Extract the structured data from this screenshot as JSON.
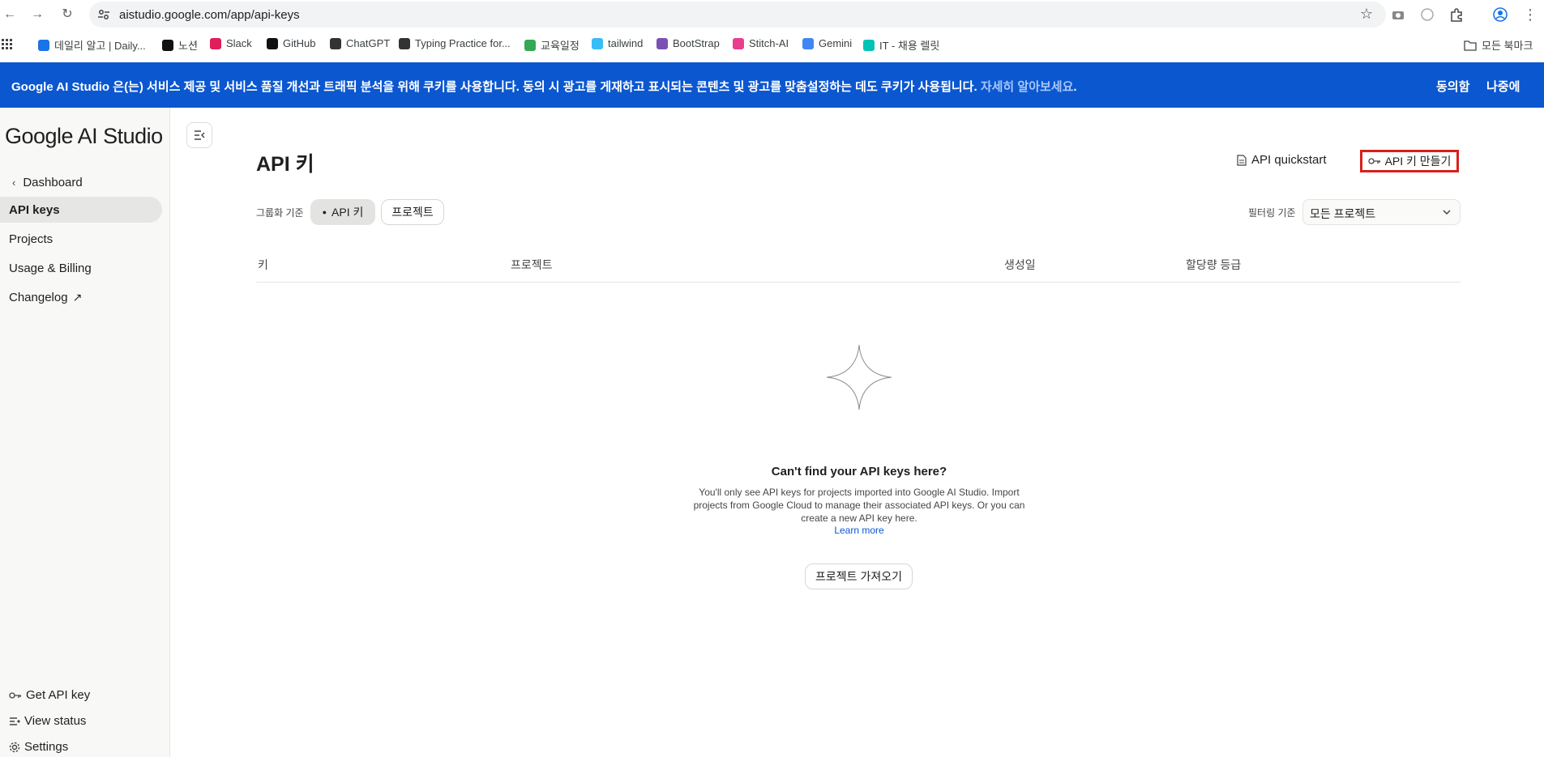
{
  "browser": {
    "url": "aistudio.google.com/app/api-keys",
    "bookmarks": [
      {
        "label": "데일리 알고 | Daily...",
        "icon": "daily-algo-icon",
        "color": "#1a73e8"
      },
      {
        "label": "노션",
        "icon": "notion-icon",
        "color": "#111111"
      },
      {
        "label": "Slack",
        "icon": "slack-icon",
        "color": "#e01e5a"
      },
      {
        "label": "GitHub",
        "icon": "github-icon",
        "color": "#111111"
      },
      {
        "label": "ChatGPT",
        "icon": "chatgpt-icon",
        "color": "#333333"
      },
      {
        "label": "Typing Practice for...",
        "icon": "lightning-icon",
        "color": "#333333"
      },
      {
        "label": "교육일정",
        "icon": "sprout-icon",
        "color": "#34a853"
      },
      {
        "label": "tailwind",
        "icon": "tailwind-icon",
        "color": "#38bdf8"
      },
      {
        "label": "BootStrap",
        "icon": "bootstrap-icon",
        "color": "#7952b3"
      },
      {
        "label": "Stitch-AI",
        "icon": "stitch-icon",
        "color": "#e83e8c"
      },
      {
        "label": "Gemini",
        "icon": "gemini-icon",
        "color": "#4285f4"
      },
      {
        "label": "IT - 채용 렐릿",
        "icon": "rallit-icon",
        "color": "#00c4b3"
      }
    ],
    "all_bookmarks": "모든 북마크"
  },
  "banner": {
    "text": "Google AI Studio 은(는) 서비스 제공 및 서비스 품질 개선과 트래픽 분석을 위해 쿠키를 사용합니다. 동의 시 광고를 게재하고 표시되는 콘텐츠 및 광고를 맞춤설정하는 데도 쿠키가 사용됩니다.",
    "link": "자세히 알아보세요",
    "period": ".",
    "accept": "동의함",
    "later": "나중에"
  },
  "sidebar": {
    "logo": "Google AI Studio",
    "back": "Dashboard",
    "items": [
      "API keys",
      "Projects",
      "Usage & Billing",
      "Changelog"
    ],
    "bottom": [
      "Get API key",
      "View status",
      "Settings"
    ]
  },
  "main": {
    "title": "API 키",
    "quickstart": "API quickstart",
    "create": "API 키 만들기",
    "group_label": "그룹화 기준",
    "chip_api": "API 키",
    "chip_project": "프로젝트",
    "filter_label": "필터링 기준",
    "filter_value": "모든 프로젝트",
    "columns": [
      "키",
      "프로젝트",
      "생성일",
      "할당량 등급"
    ],
    "empty_title": "Can't find your API keys here?",
    "empty_desc": "You'll only see API keys for projects imported into Google AI Studio. Import projects from Google Cloud to manage their associated API keys. Or you can create a new API key here.",
    "learn_more": "Learn more",
    "import": "프로젝트 가져오기"
  },
  "colors": {
    "banner": "#0b57d0",
    "highlight": "#d9201c",
    "link": "#0b57d0"
  }
}
